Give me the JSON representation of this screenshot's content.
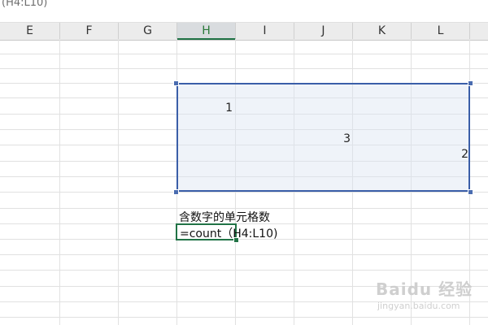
{
  "formula_bar": {
    "text": "(H4:L10)"
  },
  "columns": [
    {
      "label": "E",
      "active": false
    },
    {
      "label": "F",
      "active": false
    },
    {
      "label": "G",
      "active": false
    },
    {
      "label": "H",
      "active": true
    },
    {
      "label": "I",
      "active": false
    },
    {
      "label": "J",
      "active": false
    },
    {
      "label": "K",
      "active": false
    },
    {
      "label": "L",
      "active": false
    }
  ],
  "cells": {
    "h5": "1",
    "k7": "3",
    "l8": "2",
    "h12": "含数字的单元格数",
    "h13": "=count（H4:L10)"
  },
  "watermark": {
    "logo": "Baidu 经验",
    "url": "jingyan.baidu.com"
  }
}
